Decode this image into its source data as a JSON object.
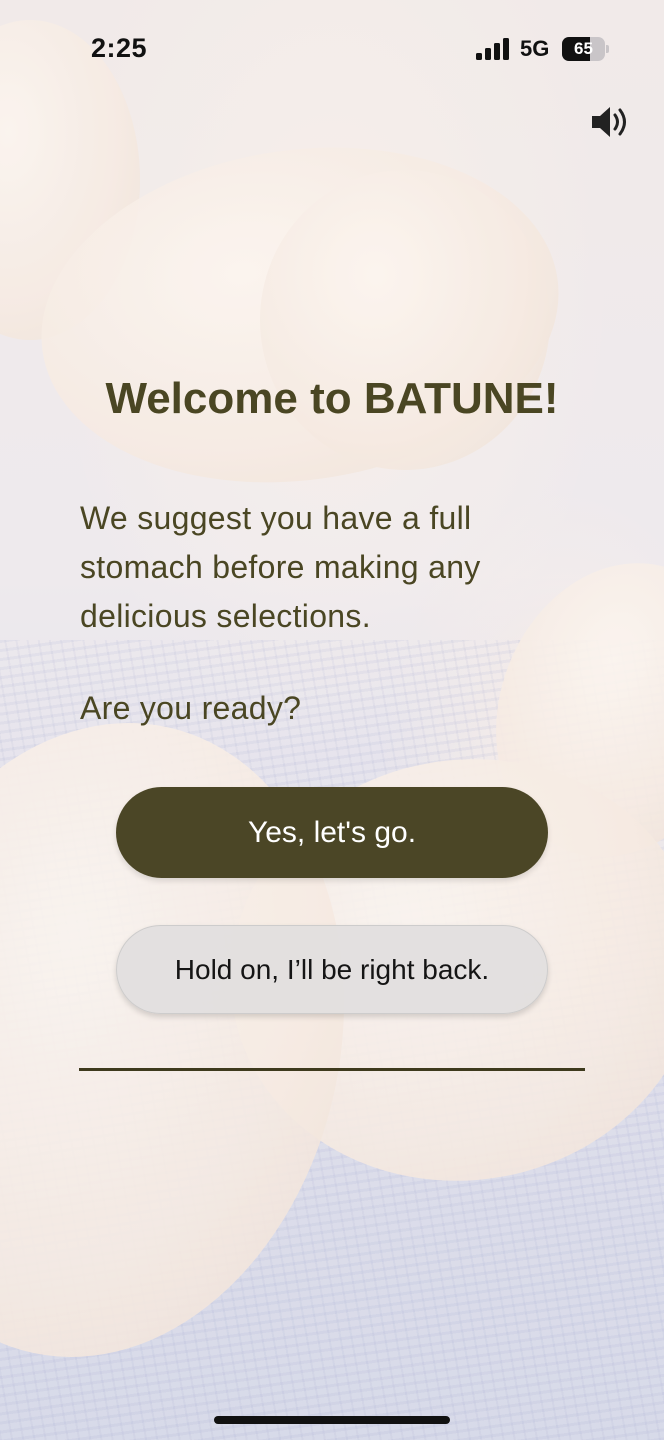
{
  "status_bar": {
    "time": "2:25",
    "network": "5G",
    "battery_level": "65",
    "battery_fraction": 0.65
  },
  "icons": {
    "speaker": "speaker-volume-icon",
    "signal": "cellular-signal-icon",
    "battery": "battery-icon"
  },
  "welcome": {
    "title": "Welcome to BATUNE!",
    "body": "We suggest you have a full stomach before making any delicious selections.",
    "prompt": "Are you ready?"
  },
  "actions": {
    "primary_label": "Yes, let's go.",
    "secondary_label": "Hold on, I’ll be right back."
  },
  "colors": {
    "accent": "#4b4626",
    "text": "#4a4623",
    "secondary_button": "#e1dede"
  }
}
